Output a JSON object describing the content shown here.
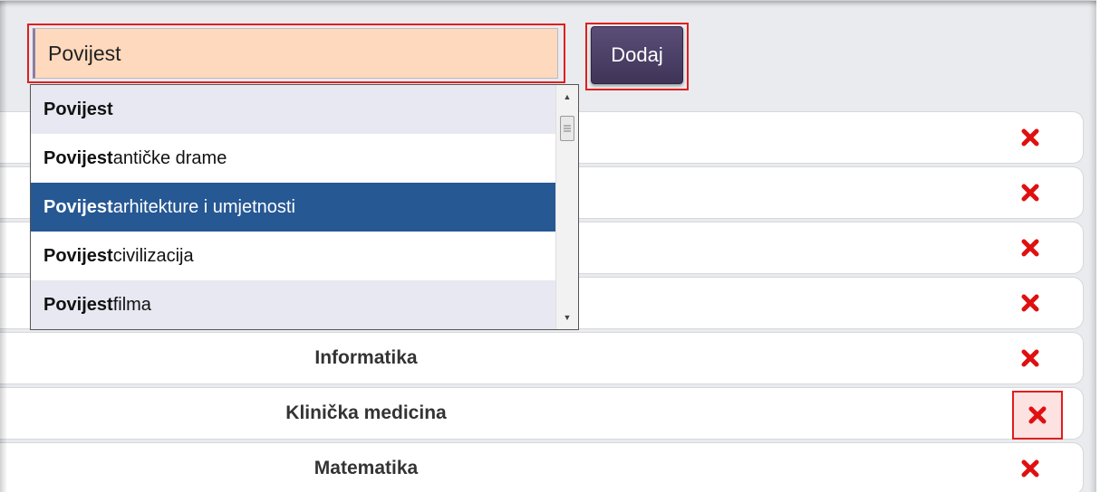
{
  "search": {
    "value": "Povijest",
    "button_label": "Dodaj"
  },
  "autocomplete": {
    "items": [
      {
        "bold": "Povijest",
        "rest": ""
      },
      {
        "bold": "Povijest",
        "rest": " antičke drame"
      },
      {
        "bold": "Povijest",
        "rest": " arhitekture i umjetnosti"
      },
      {
        "bold": "Povijest",
        "rest": " civilizacija"
      },
      {
        "bold": "Povijest",
        "rest": " filma"
      }
    ],
    "selected_index": 2
  },
  "list": {
    "rows": [
      {
        "label": ""
      },
      {
        "label": ""
      },
      {
        "label": ""
      },
      {
        "label": ""
      },
      {
        "label": "Informatika"
      },
      {
        "label": "Klinička medicina"
      },
      {
        "label": "Matematika"
      }
    ],
    "highlighted_delete_index": 5
  },
  "icons": {
    "delete": "close-x-icon",
    "scroll_up": "arrow-up-icon",
    "scroll_down": "arrow-down-icon",
    "scroll_thumb": "grip-icon"
  },
  "colors": {
    "input_bg": "#ffd9bd",
    "button_bg": "#4d4168",
    "selected_bg": "#265894",
    "delete_red": "#e01010",
    "highlight_border": "#e01e1e"
  }
}
